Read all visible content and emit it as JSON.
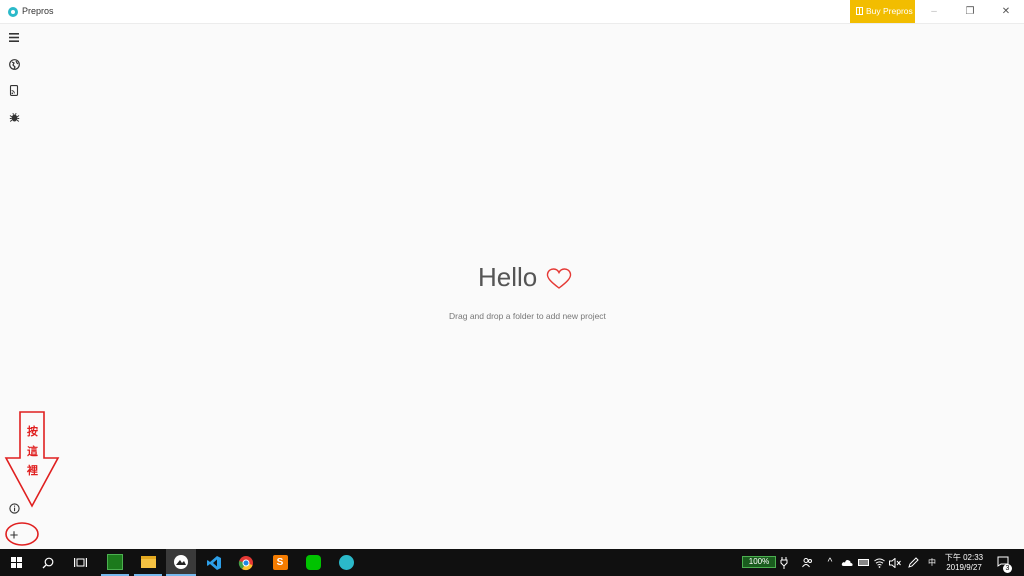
{
  "window": {
    "title": "Prepros",
    "buy_label": "Buy Prepros",
    "minimize": "–",
    "maximize": "❐",
    "close": "✕"
  },
  "sidebar": {
    "items": [
      "menu-icon",
      "globe-icon",
      "cast-icon",
      "bug-icon"
    ]
  },
  "main": {
    "greeting": "Hello",
    "hint": "Drag and drop a folder to add new project"
  },
  "annotation": {
    "chars": [
      "按",
      "這",
      "裡"
    ]
  },
  "bottom": {
    "info": "info-icon",
    "add": "+"
  },
  "taskbar": {
    "battery": "100%",
    "ime": "中",
    "time": "下午 02:33",
    "date": "2019/9/27",
    "notifications": "3"
  },
  "colors": {
    "accent": "#f2bd00",
    "brand": "#2bb9c9",
    "heart": "#e53935",
    "annotation": "#e02020"
  }
}
